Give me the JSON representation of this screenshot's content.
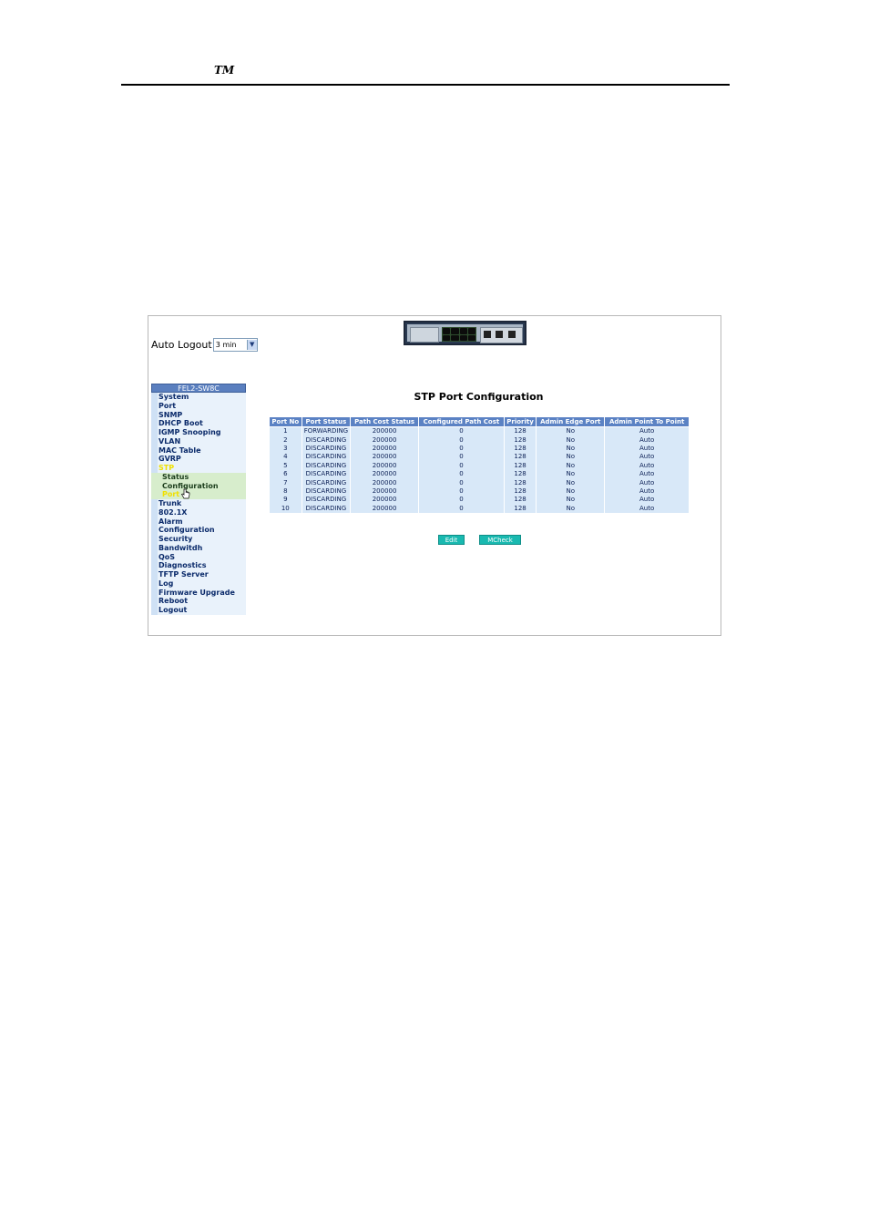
{
  "header": {
    "tm": "TM"
  },
  "app": {
    "auto_logout_label": "Auto Logout",
    "auto_logout_value": "3 min",
    "device_model": "FEL2-SW8C"
  },
  "sidebar": {
    "items": [
      {
        "label": "System"
      },
      {
        "label": "Port"
      },
      {
        "label": "SNMP"
      },
      {
        "label": "DHCP Boot"
      },
      {
        "label": "IGMP Snooping"
      },
      {
        "label": "VLAN"
      },
      {
        "label": "MAC Table"
      },
      {
        "label": "GVRP"
      },
      {
        "label": "STP"
      },
      {
        "label": "Trunk"
      },
      {
        "label": "802.1X"
      },
      {
        "label": "Alarm"
      },
      {
        "label": "Configuration"
      },
      {
        "label": "Security"
      },
      {
        "label": "Bandwitdh"
      },
      {
        "label": "QoS"
      },
      {
        "label": "Diagnostics"
      },
      {
        "label": "TFTP Server"
      },
      {
        "label": "Log"
      },
      {
        "label": "Firmware Upgrade"
      },
      {
        "label": "Reboot"
      },
      {
        "label": "Logout"
      }
    ],
    "stp_sub": [
      {
        "label": "Status"
      },
      {
        "label": "Configuration"
      },
      {
        "label": "Port"
      }
    ]
  },
  "main": {
    "title": "STP Port Configuration",
    "columns": [
      "Port No",
      "Port Status",
      "Path Cost Status",
      "Configured Path Cost",
      "Priority",
      "Admin Edge Port",
      "Admin Point To Point"
    ],
    "rows": [
      [
        "1",
        "FORWARDING",
        "200000",
        "0",
        "128",
        "No",
        "Auto"
      ],
      [
        "2",
        "DISCARDING",
        "200000",
        "0",
        "128",
        "No",
        "Auto"
      ],
      [
        "3",
        "DISCARDING",
        "200000",
        "0",
        "128",
        "No",
        "Auto"
      ],
      [
        "4",
        "DISCARDING",
        "200000",
        "0",
        "128",
        "No",
        "Auto"
      ],
      [
        "5",
        "DISCARDING",
        "200000",
        "0",
        "128",
        "No",
        "Auto"
      ],
      [
        "6",
        "DISCARDING",
        "200000",
        "0",
        "128",
        "No",
        "Auto"
      ],
      [
        "7",
        "DISCARDING",
        "200000",
        "0",
        "128",
        "No",
        "Auto"
      ],
      [
        "8",
        "DISCARDING",
        "200000",
        "0",
        "128",
        "No",
        "Auto"
      ],
      [
        "9",
        "DISCARDING",
        "200000",
        "0",
        "128",
        "No",
        "Auto"
      ],
      [
        "10",
        "DISCARDING",
        "200000",
        "0",
        "128",
        "No",
        "Auto"
      ]
    ],
    "edit_label": "Edit",
    "mcheck_label": "MCheck"
  },
  "colors": {
    "header_blue": "#5b82c4",
    "cell_blue": "#d8e8f8",
    "active_yellow": "#f0e000",
    "button_teal": "#19b9b0"
  }
}
